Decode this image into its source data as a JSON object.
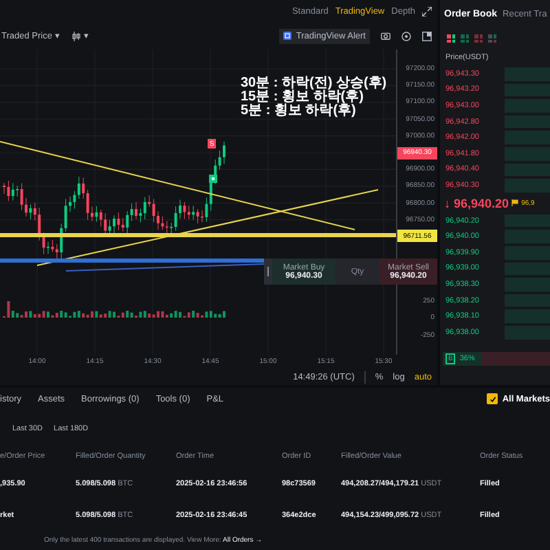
{
  "chart": {
    "view_tabs": [
      {
        "label": "Standard",
        "selected": false
      },
      {
        "label": "TradingView",
        "selected": true
      },
      {
        "label": "Depth",
        "selected": false
      }
    ],
    "price_source": "Traded Price",
    "dropdown_caret": "▾",
    "alert_button": "TradingView Alert",
    "annotation": [
      "30분 : 하락(전) 상승(후)",
      "15분 : 횡보 하락(후)",
      "5분 : 횡보 하락(후)"
    ],
    "sell_marker": "S",
    "price_axis": [
      {
        "label": "97200.00",
        "kind": "tick"
      },
      {
        "label": "97150.00",
        "kind": "tick"
      },
      {
        "label": "97100.00",
        "kind": "tick"
      },
      {
        "label": "97050.00",
        "kind": "tick"
      },
      {
        "label": "97000.00",
        "kind": "tick"
      },
      {
        "label": "96940.30",
        "kind": "last"
      },
      {
        "label": "96900.00",
        "kind": "tick"
      },
      {
        "label": "96850.00",
        "kind": "tick"
      },
      {
        "label": "96800.00",
        "kind": "tick"
      },
      {
        "label": "96750.00",
        "kind": "tick"
      },
      {
        "label": "96711.56",
        "kind": "line"
      }
    ],
    "volume_axis": [
      "250",
      "0",
      "-250"
    ],
    "time_axis": [
      "14:00",
      "14:15",
      "14:30",
      "14:45",
      "15:00",
      "15:15",
      "15:30"
    ],
    "quick_trade": {
      "buy_label": "Market Buy",
      "buy_price": "96,940.30",
      "qty_placeholder": "Qty",
      "sell_label": "Market Sell",
      "sell_price": "96,940.20"
    },
    "clock": "14:49:26 (UTC)",
    "scale_options": [
      {
        "label": "%",
        "selected": false
      },
      {
        "label": "log",
        "selected": false
      },
      {
        "label": "auto",
        "selected": true
      }
    ]
  },
  "order_book": {
    "tabs": [
      {
        "label": "Order Book",
        "selected": true
      },
      {
        "label": "Recent Tra",
        "selected": false
      }
    ],
    "views": [
      {
        "selected": true
      },
      {
        "selected": false
      },
      {
        "selected": false
      },
      {
        "selected": false
      }
    ],
    "price_header": "Price(USDT)",
    "asks": [
      "96,943.30",
      "96,943.20",
      "96,943.00",
      "96,942.80",
      "96,942.00",
      "96,941.80",
      "96,940.40",
      "96,940.30"
    ],
    "last_price": {
      "arrow": "↓",
      "price": "96,940.20",
      "mark_price": "96,9"
    },
    "bids": [
      "96,940.20",
      "96,940.00",
      "96,939.90",
      "96,939.00",
      "96,938.30",
      "96,938.20",
      "96,938.10",
      "96,938.00"
    ],
    "ratio": {
      "side": "B",
      "percent": "36%",
      "level": 0.36
    }
  },
  "orders": {
    "tabs": [
      {
        "label": "istory",
        "selected": false
      },
      {
        "label": "Assets",
        "selected": false
      },
      {
        "label": "Borrowings (0)",
        "selected": false
      },
      {
        "label": "Tools (0)",
        "selected": false
      },
      {
        "label": "P&L",
        "selected": false
      }
    ],
    "all_markets": {
      "label": "All Markets",
      "checked": true
    },
    "periods": [
      {
        "label": "Last 30D",
        "selected": false
      },
      {
        "label": "Last 180D",
        "selected": false
      }
    ],
    "columns": [
      "e/Order Price",
      "Filled/Order Quantity",
      "Order Time",
      "Order ID",
      "Filled/Order Value",
      "Order Status"
    ],
    "rows": [
      {
        "price": ",935.90",
        "quantity": "5.098/5.098",
        "quantity_unit": "BTC",
        "time": "2025-02-16 23:46:56",
        "id": "98c73569",
        "value": "494,208.27/494,179.21",
        "value_unit": "USDT",
        "status": "Filled"
      },
      {
        "price": "rket",
        "quantity": "5.098/5.098",
        "quantity_unit": "BTC",
        "time": "2025-02-16 23:46:45",
        "id": "364e2dce",
        "value": "494,154.23/499,095.72",
        "value_unit": "USDT",
        "status": "Filled"
      }
    ],
    "footer": {
      "note": "Only the latest 400 transactions are displayed. View More:",
      "link": "All Orders →"
    }
  }
}
